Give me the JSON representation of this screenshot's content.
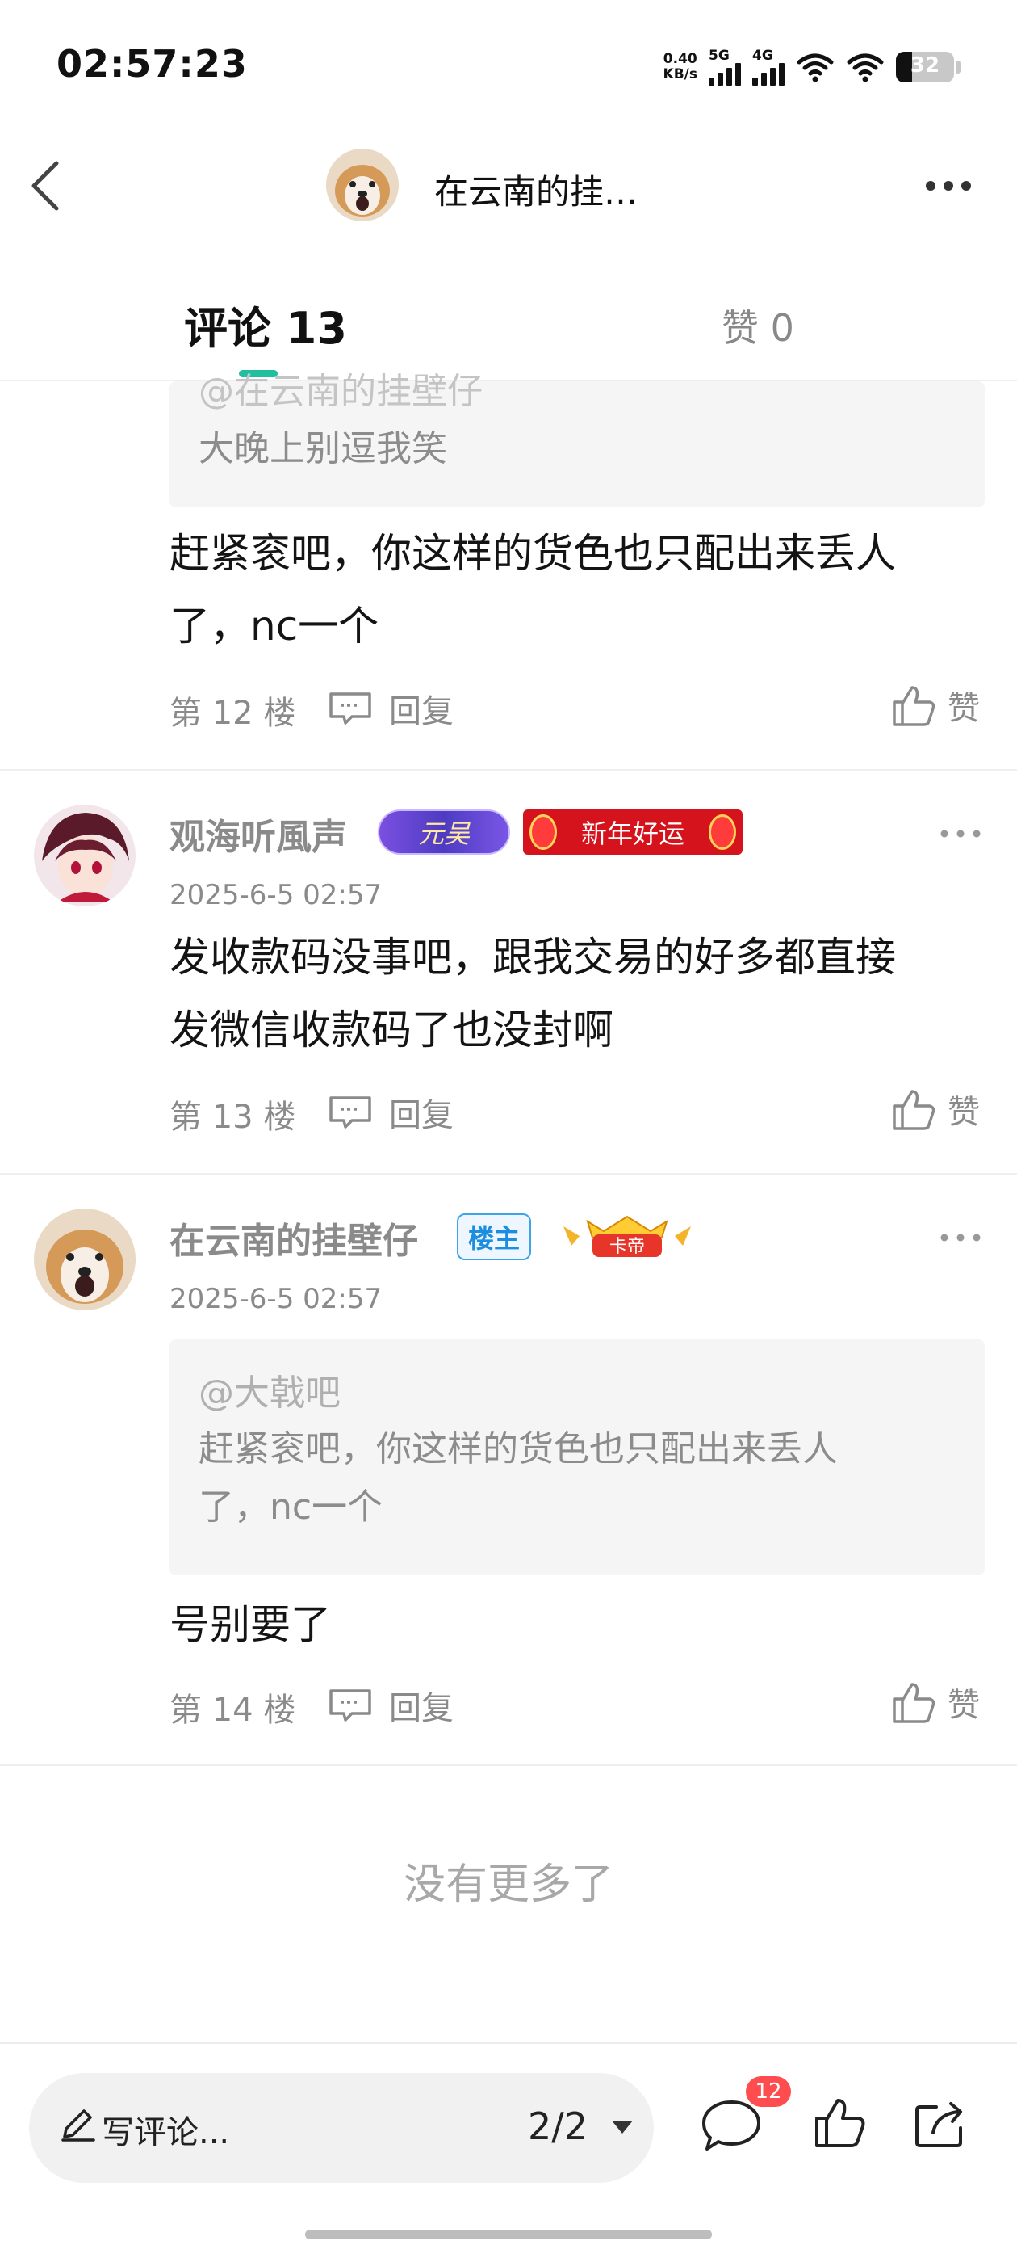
{
  "status_bar": {
    "time": "02:57:23",
    "net_speed_value": "0.40",
    "net_speed_unit": "KB/s",
    "sim1": "5G",
    "sim2": "4G",
    "battery": "32"
  },
  "header": {
    "title": "在云南的挂…"
  },
  "tabs": {
    "comments": "评论 13",
    "likes": "赞 0"
  },
  "comments": [
    {
      "quote_at": "@在云南的挂壁仔",
      "quote_text": "大晚上别逗我笑",
      "content_line1": "赶紧衮吧，你这样的货色也只配出来丢人",
      "content_line2": "了，nc一个",
      "floor": "第 12 楼",
      "reply_label": "回复",
      "like_label": "赞"
    },
    {
      "username": "观海听風声",
      "badge_yuan": "元吴",
      "badge_newyear": "新年好运",
      "time": "2025-6-5 02:57",
      "content_line1": "发收款码没事吧，跟我交易的好多都直接",
      "content_line2": "发微信收款码了也没封啊",
      "floor": "第 13 楼",
      "reply_label": "回复",
      "like_label": "赞"
    },
    {
      "username": "在云南的挂壁仔",
      "badge_owner": "楼主",
      "badge_kadi": "卡帝",
      "time": "2025-6-5 02:57",
      "quote_at": "@大戟吧",
      "quote_line1": "赶紧衮吧，你这样的货色也只配出来丢人",
      "quote_line2": "了，nc一个",
      "content_line1": "号别要了",
      "floor": "第 14 楼",
      "reply_label": "回复",
      "like_label": "赞"
    }
  ],
  "footer": {
    "no_more": "没有更多了"
  },
  "bottom_bar": {
    "compose_placeholder": "写评论...",
    "page_indicator": "2/2",
    "comment_count": "12"
  },
  "colors": {
    "accent": "#1fbfa0",
    "badge_red": "#d5131c",
    "owner_blue": "#1b8ee0",
    "count_red": "#ff4d4f"
  }
}
